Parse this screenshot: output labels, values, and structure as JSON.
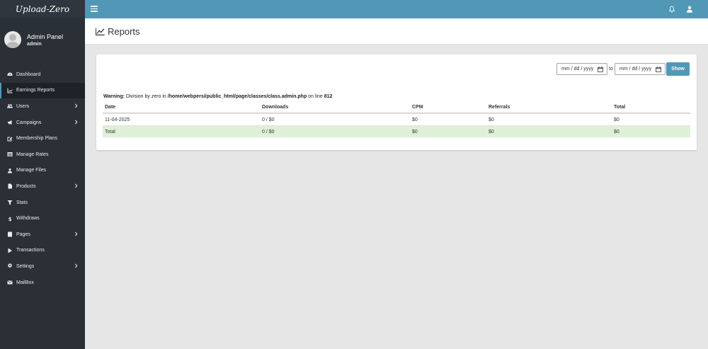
{
  "app": {
    "logo": "Upload-Zero"
  },
  "profile": {
    "name": "Admin Panel",
    "role": "admin"
  },
  "sidebar": {
    "items": [
      {
        "label": "Dashboard",
        "icon": "dashboard-icon"
      },
      {
        "label": "Earnings Reports",
        "icon": "chart-line-icon",
        "active": true
      },
      {
        "label": "Users",
        "icon": "users-icon",
        "submenu": true
      },
      {
        "label": "Campaigns",
        "icon": "bullhorn-icon",
        "submenu": true
      },
      {
        "label": "Membership Plans",
        "icon": "edit-icon"
      },
      {
        "label": "Manage Rates",
        "icon": "list-icon"
      },
      {
        "label": "Manage Files",
        "icon": "upload-icon"
      },
      {
        "label": "Products",
        "icon": "file-icon",
        "submenu": true
      },
      {
        "label": "Stats",
        "icon": "filter-icon"
      },
      {
        "label": "Withdraws",
        "icon": "dollar-icon"
      },
      {
        "label": "Pages",
        "icon": "document-icon",
        "submenu": true
      },
      {
        "label": "Transactions",
        "icon": "play-icon"
      },
      {
        "label": "Settings",
        "icon": "gear-icon",
        "submenu": true
      },
      {
        "label": "MailBox",
        "icon": "envelope-icon"
      }
    ]
  },
  "page": {
    "title": "Reports"
  },
  "filter": {
    "from_placeholder": "mm / dd / yyyy",
    "to_label": "to",
    "to_placeholder": "mm / dd / yyyy",
    "show_label": "Show"
  },
  "warning": {
    "prefix": "Warning:",
    "message": " Division by zero in ",
    "path": "/home/webpersi/public_html/page/classes/class.admin.php",
    "line_text": " on line ",
    "line": "812"
  },
  "table": {
    "headers": [
      "Date",
      "Downloads",
      "CPM",
      "Referrals",
      "Total"
    ],
    "rows": [
      [
        "11-04-2025",
        "0 / $0",
        "$0",
        "$0",
        "$0"
      ]
    ],
    "total_row": [
      "Total",
      "0 / $0",
      "$0",
      "$0",
      "$0"
    ]
  },
  "colors": {
    "accent": "#5098b6",
    "sidebar": "#2a3036",
    "total_row": "#dff0d8"
  }
}
